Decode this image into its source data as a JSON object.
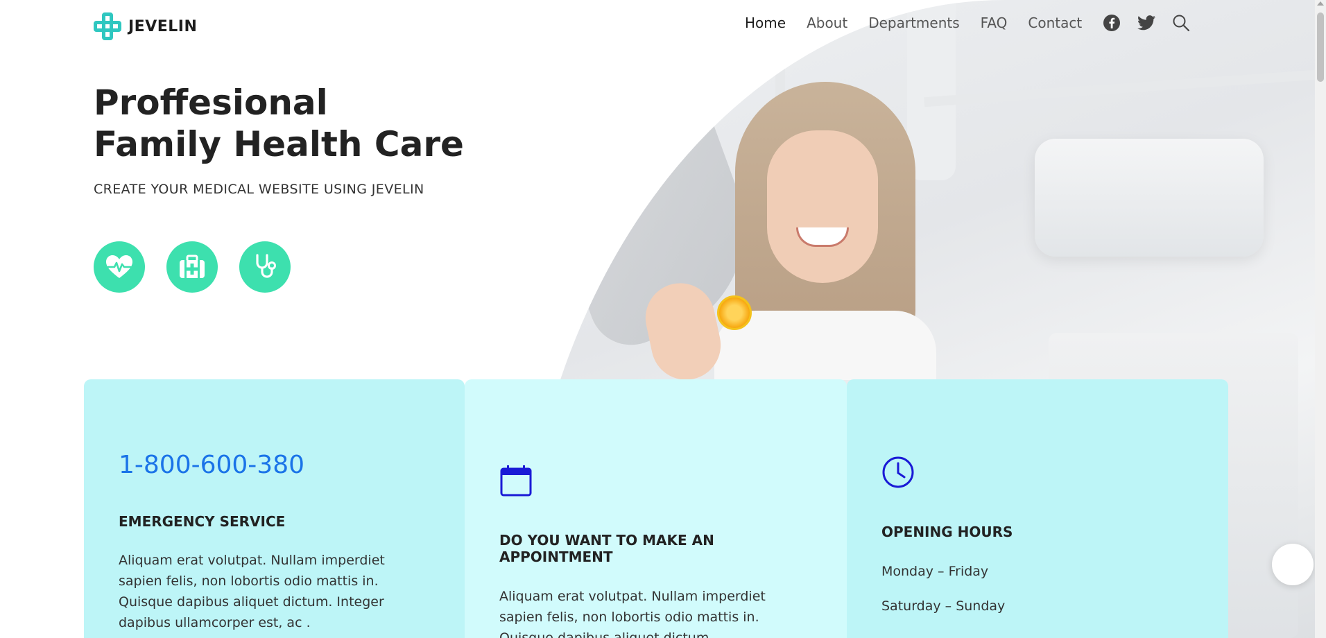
{
  "brand": {
    "name": "JEVELIN",
    "accent": "#2fc7c0"
  },
  "nav": {
    "items": [
      {
        "label": "Home",
        "active": true
      },
      {
        "label": "About"
      },
      {
        "label": "Departments"
      },
      {
        "label": "FAQ"
      },
      {
        "label": "Contact"
      }
    ],
    "icons": [
      "facebook-icon",
      "twitter-icon",
      "search-icon"
    ]
  },
  "hero": {
    "title_line1": "Proffesional",
    "title_line2": "Family Health Care",
    "subtitle": "CREATE YOUR MEDICAL WEBSITE USING JEVELIN",
    "feature_icons": [
      "heart-pulse-icon",
      "medical-kit-icon",
      "stethoscope-icon"
    ],
    "feature_color": "#3de0ae"
  },
  "cards": {
    "emergency": {
      "phone": "1-800-600-380",
      "title": "EMERGENCY SERVICE",
      "text": "Aliquam erat volutpat. Nullam imperdiet sapien felis, non lobortis odio mattis in. Quisque dapibus aliquet dictum. Integer dapibus ullamcorper est, ac ."
    },
    "appointment": {
      "icon": "calendar-icon",
      "title": "DO YOU WANT TO MAKE AN APPOINTMENT",
      "text": "Aliquam erat volutpat. Nullam imperdiet sapien felis, non lobortis odio mattis in. Quisque dapibus aliquet dictum."
    },
    "hours": {
      "icon": "clock-icon",
      "title": "OPENING HOURS",
      "row1": "Monday – Friday",
      "row2": "Saturday – Sunday"
    }
  }
}
